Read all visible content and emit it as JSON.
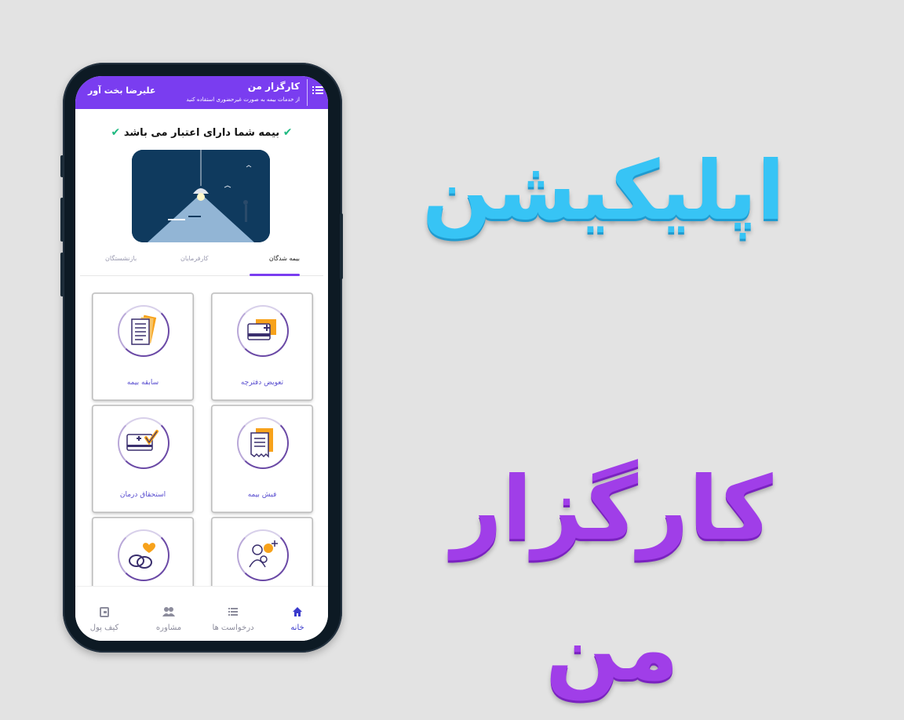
{
  "header": {
    "app_title": "کارگزار من",
    "app_subtitle": "از خدمات بیمه به صورت غیرحضوری استفاده کنید",
    "user_name": "علیرضا بخت آور"
  },
  "status": {
    "text": "بیمه شما دارای اعتبار می باشد"
  },
  "tabs": [
    {
      "label": "بیمه شدگان",
      "active": true
    },
    {
      "label": "کارفرمایان",
      "active": false
    },
    {
      "label": "بازنشستگان",
      "active": false
    }
  ],
  "services": [
    {
      "label": "تعویض دفترچه"
    },
    {
      "label": "سابقه بیمه"
    },
    {
      "label": "فیش بیمه"
    },
    {
      "label": "استحقاق درمان"
    },
    {
      "label": ""
    },
    {
      "label": ""
    }
  ],
  "bottom_nav": [
    {
      "label": "خانه",
      "active": true
    },
    {
      "label": "درخواست ها",
      "active": false
    },
    {
      "label": "مشاوره",
      "active": false
    },
    {
      "label": "کیف پول",
      "active": false
    }
  ],
  "promo": {
    "line1": "اپلیکیشن",
    "line2": "کارگزار من"
  },
  "colors": {
    "primary": "#7a3df0",
    "accent_orange": "#f7a21b",
    "check_green": "#1eb980",
    "promo_blue": "#37c4f5",
    "promo_purple": "#a03ee8"
  }
}
